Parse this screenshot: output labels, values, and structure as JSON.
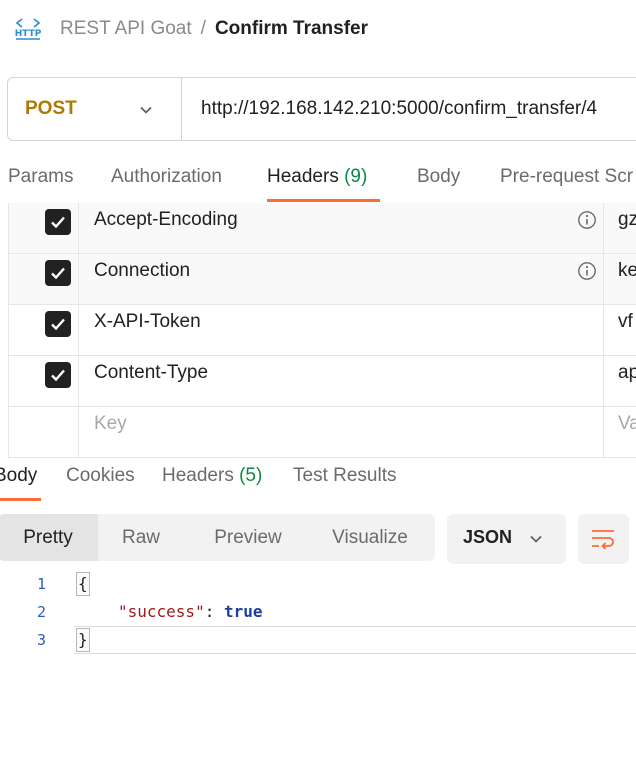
{
  "breadcrumb": {
    "icon": "http-icon",
    "icon_text": "HTTP",
    "collection": "REST API Goat",
    "separator": "/",
    "request": "Confirm Transfer"
  },
  "request": {
    "method": "POST",
    "url": "http://192.168.142.210:5000/confirm_transfer/4"
  },
  "request_tabs": [
    {
      "label": "Params",
      "count": ""
    },
    {
      "label": "Authorization",
      "count": ""
    },
    {
      "label": "Headers",
      "count": "(9)",
      "active": true
    },
    {
      "label": "Body",
      "count": ""
    },
    {
      "label": "Pre-request Scr",
      "count": ""
    }
  ],
  "headers_table": {
    "rows": [
      {
        "key": "Accept-Encoding",
        "value": "gz",
        "checked": true,
        "info": true
      },
      {
        "key": "Connection",
        "value": "ke",
        "checked": true,
        "info": true
      },
      {
        "key": "X-API-Token",
        "value": "vf",
        "checked": true,
        "info": false
      },
      {
        "key": "Content-Type",
        "value": "ap",
        "checked": true,
        "info": false
      }
    ],
    "key_placeholder": "Key",
    "value_placeholder": "Va"
  },
  "response_tabs": [
    {
      "label": "Body",
      "count": "",
      "active": true
    },
    {
      "label": "Cookies",
      "count": ""
    },
    {
      "label": "Headers",
      "count": "(5)"
    },
    {
      "label": "Test Results",
      "count": ""
    }
  ],
  "response_toolbar": {
    "views": [
      "Pretty",
      "Raw",
      "Preview",
      "Visualize"
    ],
    "active_view": "Pretty",
    "format": "JSON",
    "wrap_icon": "text-wrap-icon"
  },
  "response_body": {
    "line_numbers": [
      "1",
      "2",
      "3"
    ],
    "open_brace": "{",
    "key": "\"success\"",
    "colon": ": ",
    "value": "true",
    "close_brace": "}"
  },
  "colors": {
    "accent": "#ff6c37",
    "method_post": "#ad7a03",
    "count_green": "#0b8a44",
    "json_key": "#a11b1b",
    "json_bool": "#1b3f9b",
    "line_number": "#2a5fb8"
  }
}
